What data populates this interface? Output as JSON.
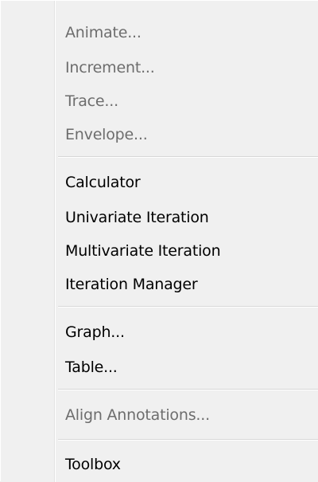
{
  "menu": {
    "groups": [
      {
        "items": [
          {
            "label": "Animate...",
            "enabled": false
          },
          {
            "label": "Increment...",
            "enabled": false
          },
          {
            "label": "Trace...",
            "enabled": false
          },
          {
            "label": "Envelope...",
            "enabled": false
          }
        ]
      },
      {
        "items": [
          {
            "label": "Calculator",
            "enabled": true
          },
          {
            "label": "Univariate Iteration",
            "enabled": true
          },
          {
            "label": "Multivariate Iteration",
            "enabled": true
          },
          {
            "label": "Iteration Manager",
            "enabled": true
          }
        ]
      },
      {
        "items": [
          {
            "label": "Graph...",
            "enabled": true
          },
          {
            "label": "Table...",
            "enabled": true
          }
        ]
      },
      {
        "items": [
          {
            "label": "Align Annotations...",
            "enabled": false
          }
        ]
      },
      {
        "items": [
          {
            "label": "Toolbox",
            "enabled": true
          }
        ]
      }
    ]
  },
  "colors": {
    "menu_background": "#f0f0f0",
    "enabled_text": "#000000",
    "disabled_text": "#6d6d6d",
    "separator": "#d7d7d7"
  }
}
